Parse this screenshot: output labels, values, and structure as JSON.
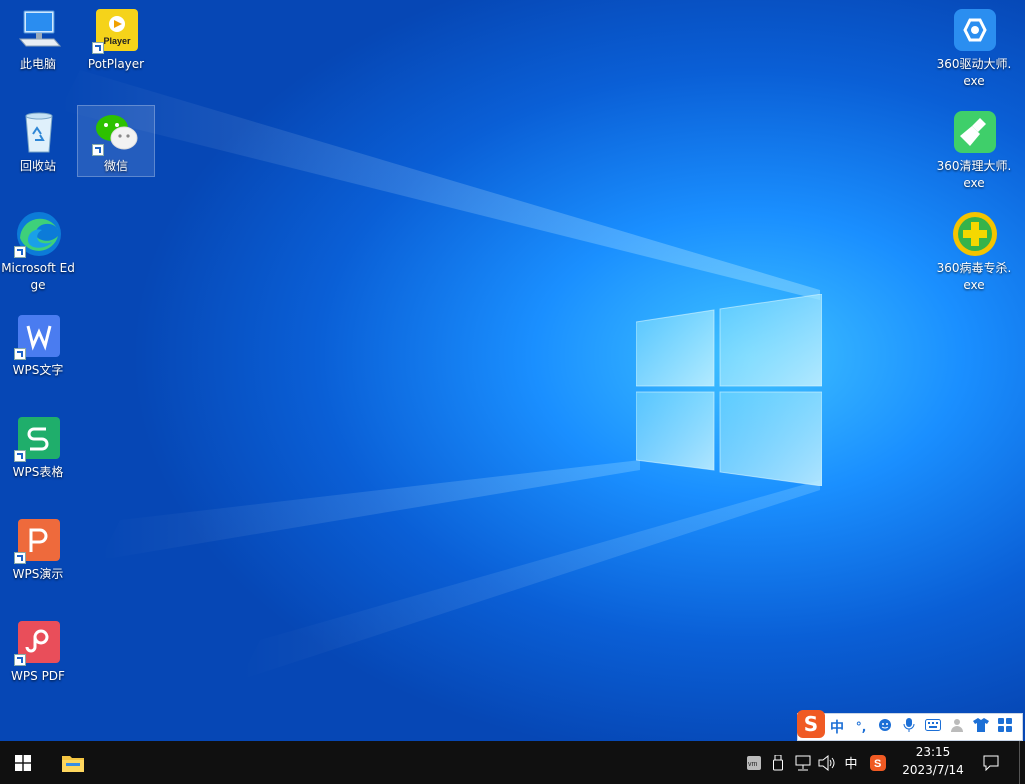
{
  "desktop": {
    "icons": {
      "this_pc": "此电脑",
      "potplayer": "PotPlayer",
      "potplayer_tile_text": "Player",
      "recycle_bin": "回收站",
      "wechat": "微信",
      "edge": "Microsoft Edge",
      "wps_writer": "WPS文字",
      "wps_sheets": "WPS表格",
      "wps_present": "WPS演示",
      "wps_pdf": "WPS PDF",
      "driver_master": "360驱动大师.exe",
      "cleaner_master": "360清理大师.exe",
      "antivirus": "360病毒专杀.exe"
    },
    "selected_icon": "微信"
  },
  "ime_toolbar": {
    "logo": "S",
    "mode": "中",
    "punct": "°,"
  },
  "taskbar": {
    "tray_ime": "中",
    "clock_time": "23:15",
    "clock_date": "2023/7/14"
  },
  "colors": {
    "desktop_center": "#3fc2ff",
    "desktop_edge": "#0647b5",
    "taskbar": "#101010",
    "sogou_orange": "#f05a23"
  }
}
